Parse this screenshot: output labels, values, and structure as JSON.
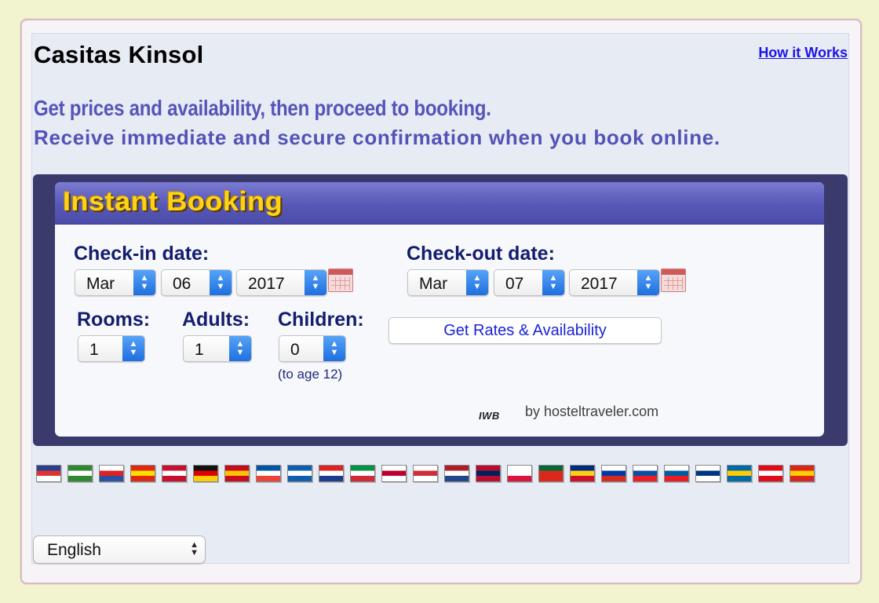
{
  "header": {
    "hostel_name": "Casitas Kinsol",
    "how_link": "How it Works",
    "headline1": "Get prices and availability, then proceed to booking.",
    "headline2": "Receive immediate and secure confirmation when you book online."
  },
  "booking": {
    "title": "Instant Booking",
    "checkin_label": "Check-in date:",
    "checkin_month": "Mar",
    "checkin_day": "06",
    "checkin_year": "2017",
    "checkout_label": "Check-out date:",
    "checkout_month": "Mar",
    "checkout_day": "07",
    "checkout_year": "2017",
    "rooms_label": "Rooms:",
    "rooms_value": "1",
    "adults_label": "Adults:",
    "adults_value": "1",
    "children_label": "Children:",
    "children_value": "0",
    "children_note": "(to age 12)",
    "rates_button": "Get Rates & Availability",
    "logo_text": "IWB",
    "byline": "by hosteltraveler.com"
  },
  "flags": [
    {
      "name": "uk-flag",
      "colors": [
        "#2b3f8f",
        "#d33",
        "#fff"
      ]
    },
    {
      "name": "arabic-flag",
      "colors": [
        "#2f8a2f",
        "#fff",
        "#2f8a2f"
      ]
    },
    {
      "name": "czech-flag",
      "colors": [
        "#fff",
        "#d22",
        "#2b4fa3"
      ]
    },
    {
      "name": "china-flag",
      "colors": [
        "#de2910",
        "#ffde00",
        "#de2910"
      ]
    },
    {
      "name": "denmark-flag",
      "colors": [
        "#c8102e",
        "#fff",
        "#c8102e"
      ]
    },
    {
      "name": "germany-flag",
      "colors": [
        "#111",
        "#d00",
        "#ffce00"
      ]
    },
    {
      "name": "spain-flag",
      "colors": [
        "#c60b1e",
        "#ffc400",
        "#c60b1e"
      ]
    },
    {
      "name": "france-flag",
      "colors": [
        "#0055a4",
        "#fff",
        "#ef4135"
      ]
    },
    {
      "name": "greece-flag",
      "colors": [
        "#0d5eaf",
        "#fff",
        "#0d5eaf"
      ]
    },
    {
      "name": "croatia-flag",
      "colors": [
        "#d22",
        "#fff",
        "#1a3c8f"
      ]
    },
    {
      "name": "italy-flag",
      "colors": [
        "#009246",
        "#fff",
        "#ce2b37"
      ]
    },
    {
      "name": "japan-flag",
      "colors": [
        "#fff",
        "#bc002d",
        "#fff"
      ]
    },
    {
      "name": "korea-flag",
      "colors": [
        "#fff",
        "#cd2e3a",
        "#fff"
      ]
    },
    {
      "name": "netherlands-flag",
      "colors": [
        "#ae1c28",
        "#fff",
        "#21468b"
      ]
    },
    {
      "name": "norway-flag",
      "colors": [
        "#ba0c2f",
        "#00205b",
        "#ba0c2f"
      ]
    },
    {
      "name": "poland-flag",
      "colors": [
        "#fff",
        "#fff",
        "#dc143c"
      ]
    },
    {
      "name": "portugal-flag",
      "colors": [
        "#046a38",
        "#da291c",
        "#da291c"
      ]
    },
    {
      "name": "romania-flag",
      "colors": [
        "#002b7f",
        "#fcd116",
        "#ce1126"
      ]
    },
    {
      "name": "russia-flag",
      "colors": [
        "#fff",
        "#0039a6",
        "#d52b1e"
      ]
    },
    {
      "name": "slovakia-flag",
      "colors": [
        "#fff",
        "#0b4ea2",
        "#ee1c25"
      ]
    },
    {
      "name": "slovenia-flag",
      "colors": [
        "#fff",
        "#005da4",
        "#ed1c24"
      ]
    },
    {
      "name": "finland-flag",
      "colors": [
        "#fff",
        "#003580",
        "#fff"
      ]
    },
    {
      "name": "sweden-flag",
      "colors": [
        "#006aa7",
        "#fecc00",
        "#006aa7"
      ]
    },
    {
      "name": "turkey-flag",
      "colors": [
        "#e30a17",
        "#fff",
        "#e30a17"
      ]
    },
    {
      "name": "vietnam-flag",
      "colors": [
        "#da251d",
        "#ffcd00",
        "#da251d"
      ]
    }
  ],
  "language": {
    "selected": "English"
  },
  "colors": {
    "page_bg": "#f2f3cf",
    "panel_bg": "#e7ebf4",
    "headline": "#5554b9",
    "booking_dark": "#3a3a6c",
    "booking_title": "#ffd21a",
    "label_navy": "#141d6e",
    "link_blue": "#1b14e6"
  }
}
